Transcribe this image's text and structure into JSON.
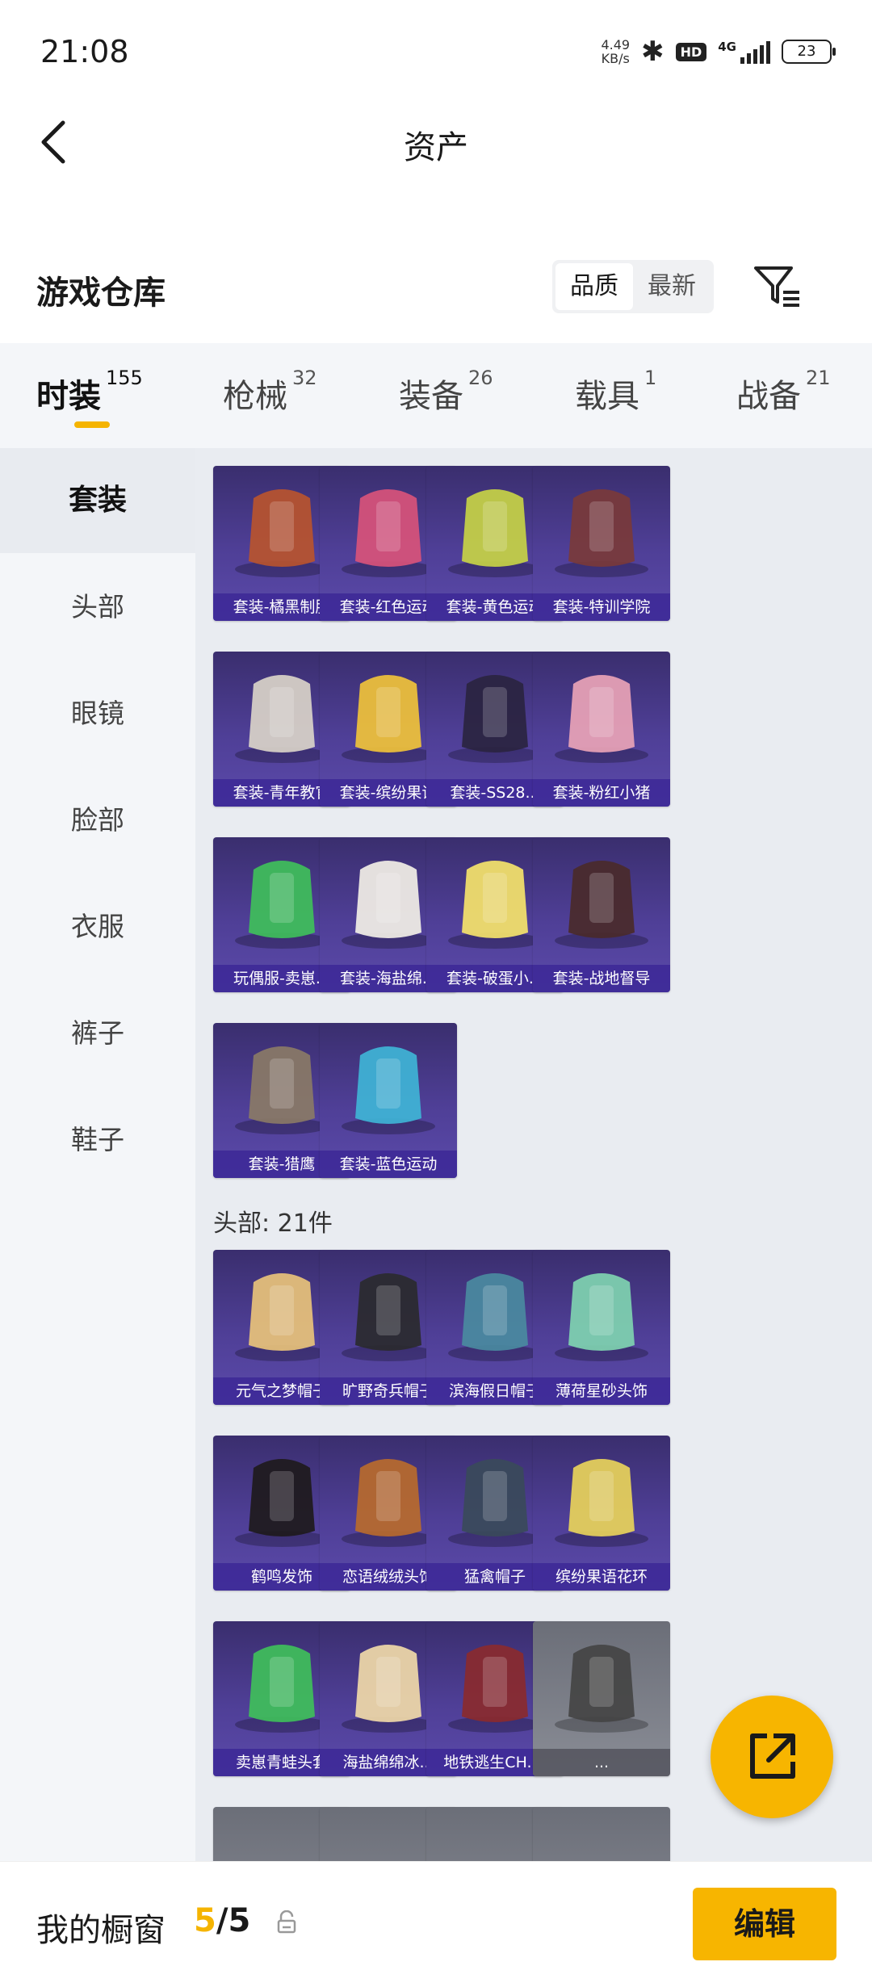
{
  "status_bar": {
    "time": "21:08",
    "net_speed_value": "4.49",
    "net_speed_unit": "KB/s",
    "hd": "HD",
    "network": "4G",
    "battery": "23"
  },
  "header": {
    "title": "资产",
    "back_icon": "chevron-left-icon"
  },
  "warehouse": {
    "title": "游戏仓库",
    "sort_options": [
      {
        "label": "品质",
        "active": true
      },
      {
        "label": "最新",
        "active": false
      }
    ],
    "filter_icon": "filter-icon"
  },
  "tabs": [
    {
      "label": "时装",
      "count": "155",
      "active": true
    },
    {
      "label": "枪械",
      "count": "32"
    },
    {
      "label": "装备",
      "count": "26"
    },
    {
      "label": "载具",
      "count": "1"
    },
    {
      "label": "战备",
      "count": "21"
    }
  ],
  "sidebar": [
    {
      "label": "套装",
      "active": true
    },
    {
      "label": "头部"
    },
    {
      "label": "眼镜"
    },
    {
      "label": "脸部"
    },
    {
      "label": "衣服"
    },
    {
      "label": "裤子"
    },
    {
      "label": "鞋子"
    }
  ],
  "suits": [
    {
      "label": "套装-橘黑制服",
      "accent": "#b8542e"
    },
    {
      "label": "套装-红色运动",
      "accent": "#d8527a"
    },
    {
      "label": "套装-黄色运动",
      "accent": "#c7d245"
    },
    {
      "label": "套装-特训学院",
      "accent": "#7a3a3a"
    },
    {
      "label": "套装-青年教官",
      "accent": "#d9d2c8"
    },
    {
      "label": "套装-缤纷果语",
      "accent": "#f0c23a"
    },
    {
      "label": "套装-SS28...",
      "accent": "#2a2440"
    },
    {
      "label": "套装-粉红小猪",
      "accent": "#e9a3b6"
    },
    {
      "label": "玩偶服-卖崽...",
      "accent": "#3fbf5a"
    },
    {
      "label": "套装-海盐绵...",
      "accent": "#f2efe6"
    },
    {
      "label": "套装-破蛋小...",
      "accent": "#f5e36a"
    },
    {
      "label": "套装-战地督导",
      "accent": "#4a2a2a"
    },
    {
      "label": "套装-猎鹰",
      "accent": "#8a7a66"
    },
    {
      "label": "套装-蓝色运动",
      "accent": "#3fb4d6"
    }
  ],
  "head_group": {
    "title": "头部: 21件",
    "items": [
      {
        "label": "元气之梦帽子",
        "accent": "#e8c27a"
      },
      {
        "label": "旷野奇兵帽子",
        "accent": "#2a2a2e"
      },
      {
        "label": "滨海假日帽子",
        "accent": "#4a8aa0"
      },
      {
        "label": "薄荷星砂头饰",
        "accent": "#7fd3b0"
      },
      {
        "label": "鹤鸣发饰",
        "accent": "#1e1a1c"
      },
      {
        "label": "恋语绒绒头饰",
        "accent": "#b86a2c"
      },
      {
        "label": "猛禽帽子",
        "accent": "#3a4a5a"
      },
      {
        "label": "缤纷果语花环",
        "accent": "#e8d25a"
      },
      {
        "label": "卖崽青蛙头套",
        "accent": "#3fbf5a"
      },
      {
        "label": "海盐绵绵冰...",
        "accent": "#f0d9a8"
      },
      {
        "label": "地铁逃生CH....",
        "accent": "#8a2a2e"
      },
      {
        "label": "...",
        "accent": "#444444"
      }
    ]
  },
  "fab_icon": "share-external-icon",
  "bottom_bar": {
    "showcase_label": "我的橱窗",
    "current": "5",
    "separator": "/",
    "total": "5",
    "lock_icon": "lock-icon",
    "edit_label": "编辑"
  }
}
